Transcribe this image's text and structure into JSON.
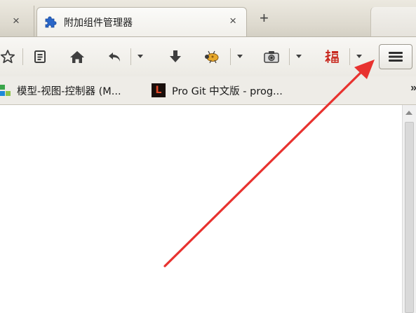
{
  "tabs": {
    "previous_close": "×",
    "active": {
      "title": "附加组件管理器",
      "icon": "puzzle-piece-icon",
      "close": "×"
    },
    "new_tab": "+"
  },
  "toolbar": {
    "buttons": [
      {
        "name": "bookmark-star-icon"
      },
      {
        "name": "reading-list-icon"
      },
      {
        "name": "home-icon"
      },
      {
        "name": "undo-icon"
      },
      {
        "name": "download-icon"
      },
      {
        "name": "bug-icon"
      },
      {
        "name": "screenshot-camera-icon"
      },
      {
        "name": "fortune-fu-icon"
      },
      {
        "name": "hamburger-menu-icon"
      }
    ]
  },
  "bookmarks": {
    "items": [
      {
        "label": "模型-视图-控制器 (M...",
        "icon": "colored-squares-icon"
      },
      {
        "label": "Pro Git 中文版 - prog...",
        "icon": "letter-l-icon",
        "icon_text": "L"
      }
    ],
    "overflow": "»"
  },
  "annotation": {
    "arrow_color": "#e8322f"
  },
  "accent": {
    "tab_icon_color": "#2a66c8",
    "fu_color": "#c8281e"
  }
}
